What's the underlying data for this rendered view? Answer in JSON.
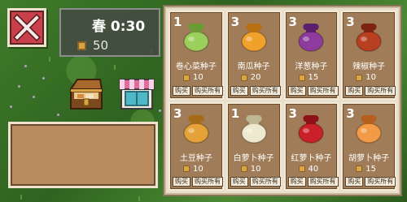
{
  "hud": {
    "season_time": "春 0:30",
    "coins": "50"
  },
  "shop": {
    "buy_label": "购买",
    "buy_all_label": "购买所有",
    "items": [
      {
        "count": "1",
        "name": "卷心菜种子",
        "price": "10",
        "color": "#9ccf5b",
        "knot": "#6a9b34"
      },
      {
        "count": "3",
        "name": "南瓜种子",
        "price": "20",
        "color": "#f0a12c",
        "knot": "#b86f12"
      },
      {
        "count": "3",
        "name": "洋葱种子",
        "price": "15",
        "color": "#8e3b9e",
        "knot": "#5c1f6b"
      },
      {
        "count": "3",
        "name": "辣椒种子",
        "price": "10",
        "color": "#b93f21",
        "knot": "#7c2410"
      },
      {
        "count": "3",
        "name": "土豆种子",
        "price": "10",
        "color": "#e5a238",
        "knot": "#a46b18"
      },
      {
        "count": "1",
        "name": "白萝卜种子",
        "price": "10",
        "color": "#efeacf",
        "knot": "#bdb794"
      },
      {
        "count": "3",
        "name": "红萝卜种子",
        "price": "40",
        "color": "#c9202a",
        "knot": "#8c1118"
      },
      {
        "count": "3",
        "name": "胡萝卜种子",
        "price": "15",
        "color": "#f29a45",
        "knot": "#b5601e"
      }
    ]
  }
}
